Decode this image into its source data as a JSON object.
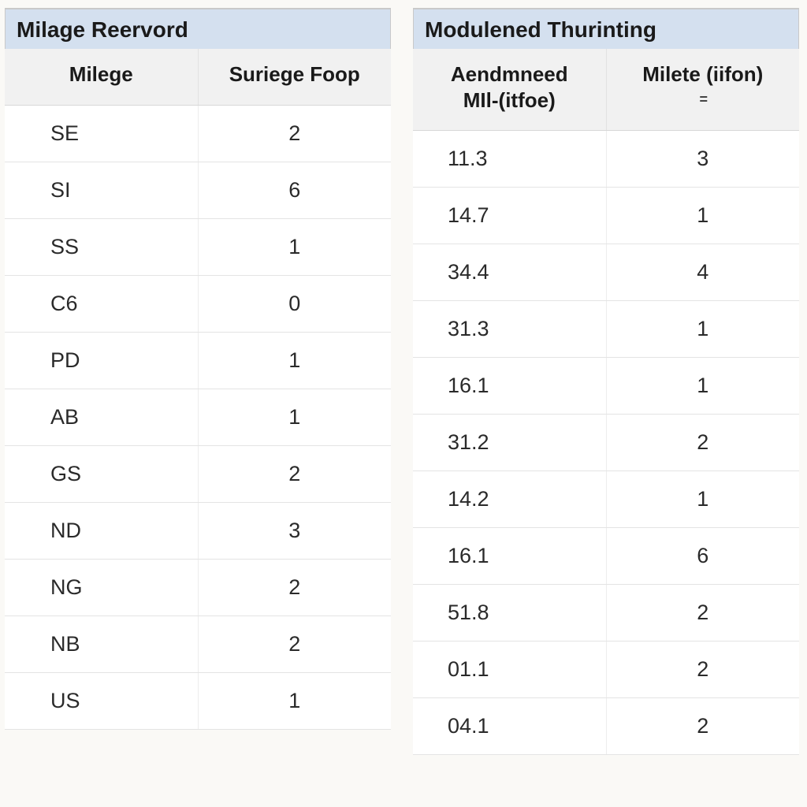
{
  "chart_data": [
    {
      "type": "table",
      "title": "Milage Reervord",
      "columns": [
        "Milege",
        "Suriege Foop"
      ],
      "rows": [
        [
          "SE",
          2
        ],
        [
          "SI",
          6
        ],
        [
          "SS",
          1
        ],
        [
          "C6",
          0
        ],
        [
          "PD",
          1
        ],
        [
          "AB",
          1
        ],
        [
          "GS",
          2
        ],
        [
          "ND",
          3
        ],
        [
          "NG",
          2
        ],
        [
          "NB",
          2
        ],
        [
          "US",
          1
        ]
      ]
    },
    {
      "type": "table",
      "title": "Modulened Thurinting",
      "columns": [
        "Aendmneed MIl-(itfoe)",
        "Milete (iifon)"
      ],
      "rows": [
        [
          11.3,
          3
        ],
        [
          14.7,
          1
        ],
        [
          34.4,
          4
        ],
        [
          31.3,
          1
        ],
        [
          16.1,
          1
        ],
        [
          31.2,
          2
        ],
        [
          14.2,
          1
        ],
        [
          16.1,
          6
        ],
        [
          51.8,
          2
        ],
        [
          "01.1",
          2
        ],
        [
          "04.1",
          2
        ]
      ]
    }
  ],
  "left_table": {
    "title": "Milage Reervord",
    "col0": "Milege",
    "col1": "Suriege Foop",
    "rows": {
      "0": {
        "c0": "SE",
        "c1": "2"
      },
      "1": {
        "c0": "SI",
        "c1": "6"
      },
      "2": {
        "c0": "SS",
        "c1": "1"
      },
      "3": {
        "c0": "C6",
        "c1": "0"
      },
      "4": {
        "c0": "PD",
        "c1": "1"
      },
      "5": {
        "c0": "AB",
        "c1": "1"
      },
      "6": {
        "c0": "GS",
        "c1": "2"
      },
      "7": {
        "c0": "ND",
        "c1": "3"
      },
      "8": {
        "c0": "NG",
        "c1": "2"
      },
      "9": {
        "c0": "NB",
        "c1": "2"
      },
      "10": {
        "c0": "US",
        "c1": "1"
      }
    }
  },
  "right_table": {
    "title": "Modulened Thurinting",
    "col0_line1": "Aendmneed",
    "col0_line2": "MIl-(itfoe)",
    "col1": "Milete (iifon)",
    "sort_glyph": "=",
    "rows": {
      "0": {
        "c0": "11.3",
        "c1": "3"
      },
      "1": {
        "c0": "14.7",
        "c1": "1"
      },
      "2": {
        "c0": "34.4",
        "c1": "4"
      },
      "3": {
        "c0": "31.3",
        "c1": "1"
      },
      "4": {
        "c0": "16.1",
        "c1": "1"
      },
      "5": {
        "c0": "31.2",
        "c1": "2"
      },
      "6": {
        "c0": "14.2",
        "c1": "1"
      },
      "7": {
        "c0": "16.1",
        "c1": "6"
      },
      "8": {
        "c0": "51.8",
        "c1": "2"
      },
      "9": {
        "c0": "01.1",
        "c1": "2"
      },
      "10": {
        "c0": "04.1",
        "c1": "2"
      }
    }
  }
}
